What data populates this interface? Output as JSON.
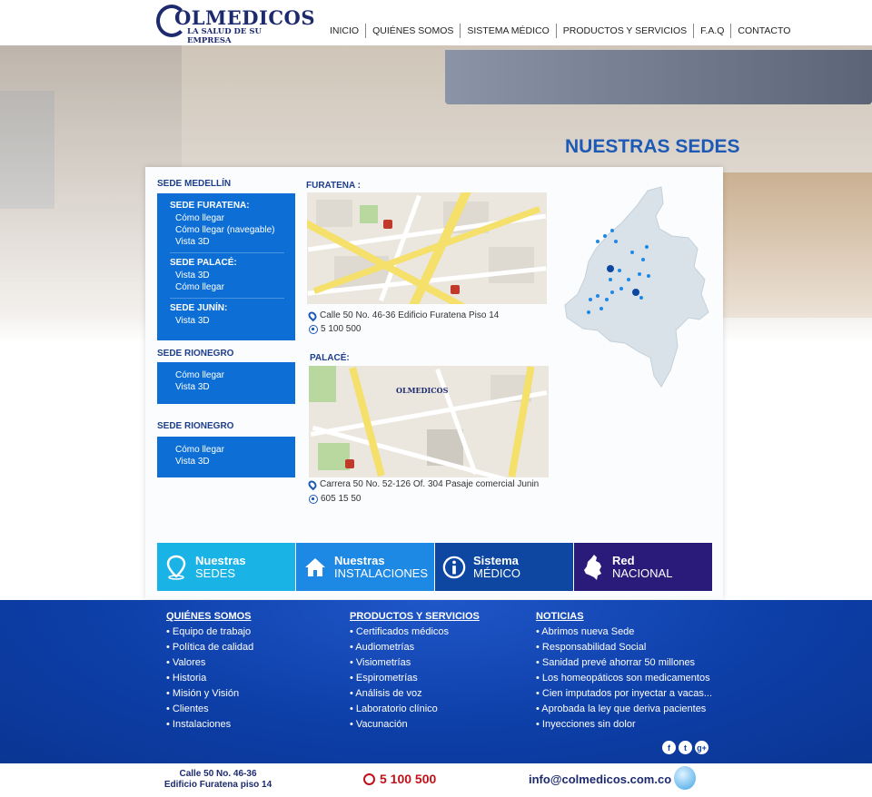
{
  "header": {
    "logo_text": "OLMEDICOS",
    "logo_tagline": "LA SALUD DE SU EMPRESA",
    "nav": [
      "INICIO",
      "QUIÉNES SOMOS",
      "SISTEMA MÉDICO",
      "PRODUCTOS Y SERVICIOS",
      "F.A.Q",
      "CONTACTO"
    ]
  },
  "page_title": "NUESTRAS SEDES",
  "sidebar": {
    "medellin_heading": "SEDE MEDELLÍN",
    "furatena_title": "SEDE FURATENA:",
    "furatena_links": [
      "Cómo llegar",
      "Cómo llegar (navegable)",
      "Vista 3D"
    ],
    "palace_title": "SEDE PALACÉ:",
    "palace_links": [
      "Vista 3D",
      "Cómo llegar"
    ],
    "junin_title": "SEDE JUNÍN:",
    "junin_links": [
      "Vista 3D"
    ],
    "rionegro1_heading": "SEDE RIONEGRO",
    "rionegro1_links": [
      "Cómo llegar",
      "Vista 3D"
    ],
    "rionegro2_heading": "SEDE RIONEGRO",
    "rionegro2_links": [
      "Cómo llegar",
      "Vista 3D"
    ]
  },
  "locations": {
    "furatena_label": "FURATENA :",
    "furatena_address": "Calle 50 No. 46-36  Edificio Furatena Piso 14",
    "furatena_phone": "5 100 500",
    "palace_label": "PALACÉ:",
    "palace_map_logo": "OLMEDICOS",
    "palace_address": "Carrera 50 No. 52-126 Of. 304 Pasaje comercial Junin",
    "palace_phone": "605 15 50"
  },
  "features": [
    {
      "line1": "Nuestras",
      "line2": "SEDES",
      "color": "#19b3e6",
      "icon": "location-icon"
    },
    {
      "line1": "Nuestras",
      "line2": "INSTALACIONES",
      "color": "#1e88e5",
      "icon": "home-icon"
    },
    {
      "line1": "Sistema",
      "line2": "MÉDICO",
      "color": "#0d47a1",
      "icon": "info-icon"
    },
    {
      "line1": "Red",
      "line2": "NACIONAL",
      "color": "#2a1b7a",
      "icon": "colombia-map-icon"
    }
  ],
  "footer": {
    "col1_heading": "QUIÉNES SOMOS",
    "col1_items": [
      "• Equipo de trabajo",
      "• Política de calidad",
      "• Valores",
      "• Historia",
      "• Misión y Visión",
      "• Clientes",
      "• Instalaciones"
    ],
    "col2_heading": "PRODUCTOS Y SERVICIOS",
    "col2_items": [
      "• Certificados médicos",
      "• Audiometrías",
      "• Visiometrías",
      "• Espirometrías",
      "• Análisis de voz",
      "• Laboratorio clínico",
      "• Vacunación"
    ],
    "col3_heading": "NOTICIAS",
    "col3_items": [
      "• Abrimos nueva Sede",
      "• Responsabilidad Social",
      "• Sanidad prevé ahorrar 50 millones",
      "• Los homeopáticos son medicamentos",
      "• Cien imputados por inyectar a vacas...",
      "• Aprobada la ley que deriva pacientes",
      "• Inyecciones sin dolor"
    ],
    "social": [
      "f",
      "t",
      "g+"
    ]
  },
  "bottom_bar": {
    "address_line1": "Calle 50 No. 46-36",
    "address_line2": "Edificio Furatena piso 14",
    "phone": "5 100 500",
    "email": "info@colmedicos.com.co"
  }
}
